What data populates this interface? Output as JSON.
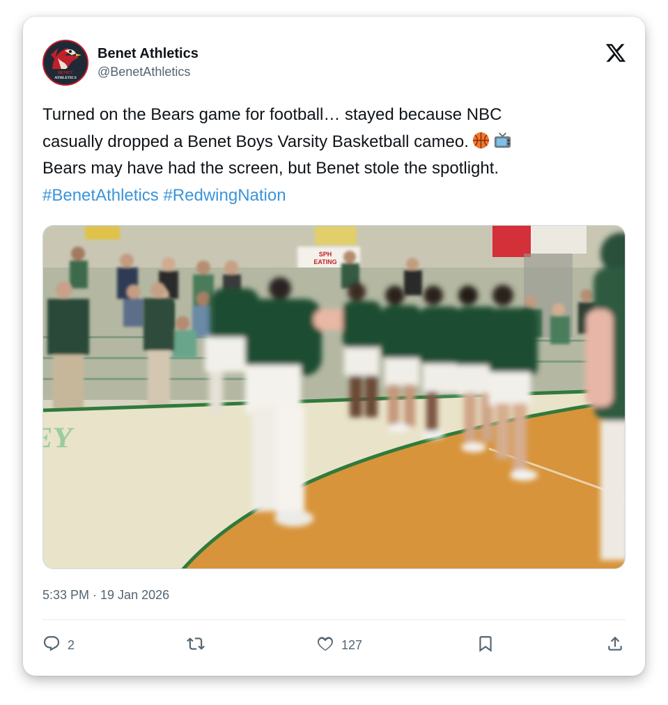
{
  "author": {
    "display_name": "Benet Athletics",
    "handle": "@BenetAthletics",
    "avatar_text_1": "BENET",
    "avatar_text_2": "ATHLETICS"
  },
  "tweet": {
    "line1": "Turned on the Bears game for football… stayed because NBC",
    "line2": "casually dropped a Benet Boys Varsity Basketball cameo.",
    "line3": "Bears may have had the screen, but Benet stole the spotlight.",
    "hashtags": [
      "#BenetAthletics",
      "#RedwingNation"
    ],
    "emojis": [
      "basketball-emoji",
      "television-emoji"
    ]
  },
  "media": {
    "court_text": "LEY",
    "banner_text_1": "SPH",
    "banner_text_2": "EATING"
  },
  "timestamp": "5:33 PM · 19 Jan 2026",
  "actions": {
    "reply_count": "2",
    "retweet_count": "",
    "like_count": "127"
  },
  "icons": {
    "platform": "x-logo-icon",
    "reply": "reply-icon",
    "retweet": "retweet-icon",
    "like": "heart-icon",
    "bookmark": "bookmark-icon",
    "share": "share-icon"
  },
  "colors": {
    "hashtag": "#3b94d9",
    "secondary_text": "#536471",
    "primary_text": "#0f1419",
    "jersey_green": "#1f4d33"
  }
}
